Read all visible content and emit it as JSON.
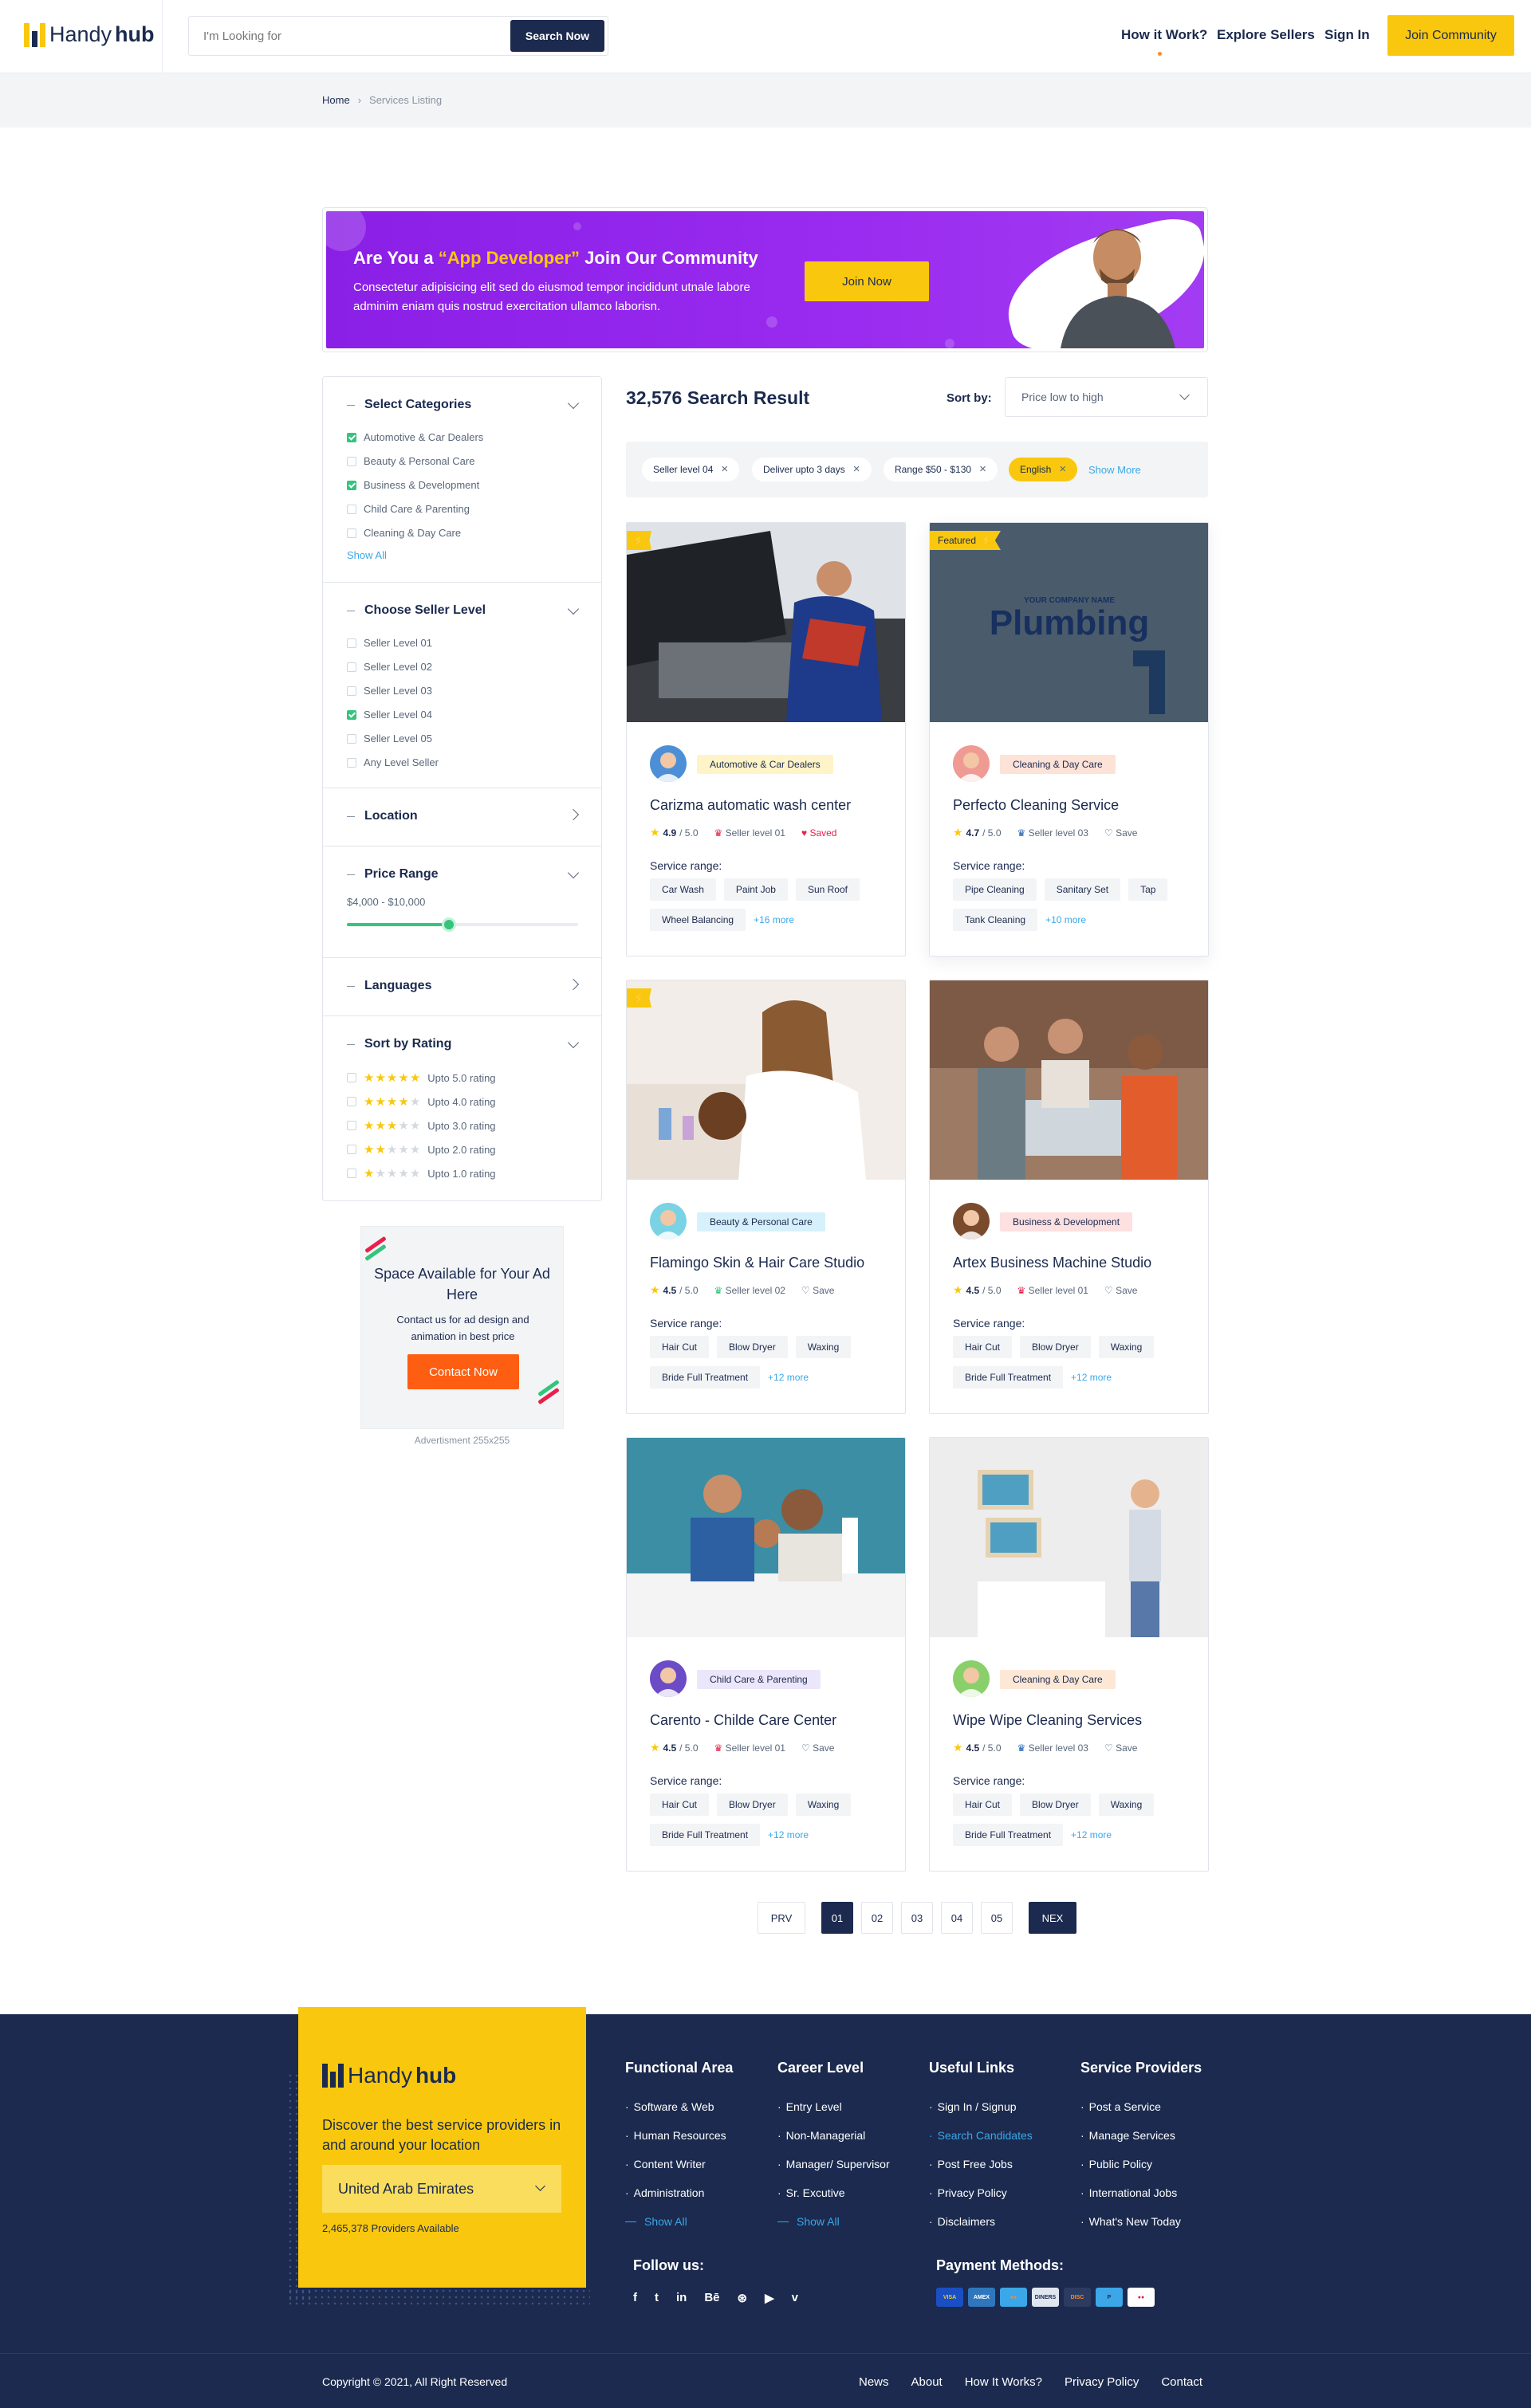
{
  "header": {
    "logo_light": "Handy",
    "logo_bold": "hub",
    "search_placeholder": "I'm Looking for",
    "search_button": "Search Now",
    "nav": [
      "How it Work?",
      "Explore Sellers",
      "Sign In"
    ],
    "join_button": "Join Community"
  },
  "breadcrumb": {
    "home": "Home",
    "separator": "›",
    "current": "Services Listing"
  },
  "banner": {
    "title_pre": "Are You a ",
    "title_highlight": "“App Developer”",
    "title_post": " Join Our Community",
    "text": "Consectetur adipisicing elit sed do eiusmod tempor incididunt utnale labore adminim eniam quis nostrud exercitation ullamco laborisn.",
    "button": "Join Now"
  },
  "filters": {
    "categories": {
      "title": "Select Categories",
      "options": [
        {
          "label": "Automotive & Car Dealers",
          "checked": true
        },
        {
          "label": "Beauty & Personal Care",
          "checked": false
        },
        {
          "label": "Business & Development",
          "checked": true
        },
        {
          "label": "Child Care & Parenting",
          "checked": false
        },
        {
          "label": "Cleaning & Day Care",
          "checked": false
        }
      ],
      "show_all": "Show All"
    },
    "seller_level": {
      "title": "Choose Seller Level",
      "options": [
        {
          "label": "Seller Level 01",
          "checked": false
        },
        {
          "label": "Seller Level 02",
          "checked": false
        },
        {
          "label": "Seller Level 03",
          "checked": false
        },
        {
          "label": "Seller Level 04",
          "checked": true
        },
        {
          "label": "Seller Level 05",
          "checked": false
        },
        {
          "label": "Any Level Seller",
          "checked": false
        }
      ]
    },
    "location": {
      "title": "Location"
    },
    "price": {
      "title": "Price Range",
      "value": "$4,000 - $10,000",
      "fraction": 0.44
    },
    "languages": {
      "title": "Languages"
    },
    "rating": {
      "title": "Sort by Rating",
      "options": [
        {
          "label": "Upto 5.0 rating",
          "stars": 5
        },
        {
          "label": "Upto 4.0 rating",
          "stars": 4
        },
        {
          "label": "Upto 3.0 rating",
          "stars": 3
        },
        {
          "label": "Upto 2.0 rating",
          "stars": 2
        },
        {
          "label": "Upto 1.0 rating",
          "stars": 1
        }
      ]
    }
  },
  "ad": {
    "title": "Space Available for Your Ad Here",
    "text": "Contact us for ad design and animation in best price",
    "button": "Contact Now",
    "caption": "Advertisment 255x255"
  },
  "results": {
    "count_title": "32,576 Search Result",
    "sort_label": "Sort by:",
    "sort_value": "Price low to high",
    "chips": [
      "Seller level 04",
      "Deliver upto 3 days",
      "Range $50 - $130",
      "English"
    ],
    "chip_remove": "×",
    "show_more": "Show More"
  },
  "cards": [
    {
      "badge": "",
      "category": "Automotive & Car Dealers",
      "cat_color": "#fff4c7",
      "title": "Carizma automatic wash center",
      "rating": "4.9",
      "rating_max": "/ 5.0",
      "level": "Seller level 01",
      "save": "Saved",
      "saved": true,
      "range_label": "Service range:",
      "tags": [
        "Car Wash",
        "Paint Job",
        "Sun Roof",
        "Wheel Balancing"
      ],
      "more": "+16 more"
    },
    {
      "badge": "Featured",
      "category": "Cleaning & Day Care",
      "cat_color": "#fde2d8",
      "title": "Perfecto Cleaning Service",
      "rating": "4.7",
      "rating_max": "/ 5.0",
      "level": "Seller level 03",
      "save": "Save",
      "saved": false,
      "range_label": "Service range:",
      "tags": [
        "Pipe Cleaning",
        "Sanitary Set",
        "Tap",
        "Tank Cleaning"
      ],
      "more": "+10 more",
      "image_text_a": "YOUR COMPANY NAME",
      "image_text_b": "Plumbing"
    },
    {
      "badge": "",
      "category": "Beauty & Personal Care",
      "cat_color": "#d6f1fb",
      "title": "Flamingo Skin & Hair Care Studio",
      "rating": "4.5",
      "rating_max": "/ 5.0",
      "level": "Seller level 02",
      "save": "Save",
      "saved": false,
      "range_label": "Service range:",
      "tags": [
        "Hair Cut",
        "Blow Dryer",
        "Waxing",
        "Bride Full Treatment"
      ],
      "more": "+12 more"
    },
    {
      "badge": "",
      "category": "Business & Development",
      "cat_color": "#fde0e0",
      "title": "Artex Business Machine Studio",
      "rating": "4.5",
      "rating_max": "/ 5.0",
      "level": "Seller level 01",
      "save": "Save",
      "saved": false,
      "range_label": "Service range:",
      "tags": [
        "Hair Cut",
        "Blow Dryer",
        "Waxing",
        "Bride Full Treatment"
      ],
      "more": "+12 more"
    },
    {
      "badge": "",
      "category": "Child Care & Parenting",
      "cat_color": "#ece6fb",
      "title": "Carento - Childe Care Center",
      "rating": "4.5",
      "rating_max": "/ 5.0",
      "level": "Seller level 01",
      "save": "Save",
      "saved": false,
      "range_label": "Service range:",
      "tags": [
        "Hair Cut",
        "Blow Dryer",
        "Waxing",
        "Bride Full Treatment"
      ],
      "more": "+12 more"
    },
    {
      "badge": "",
      "category": "Cleaning & Day Care",
      "cat_color": "#fde8d6",
      "title": "Wipe Wipe Cleaning Services",
      "rating": "4.5",
      "rating_max": "/ 5.0",
      "level": "Seller level 03",
      "save": "Save",
      "saved": false,
      "range_label": "Service range:",
      "tags": [
        "Hair Cut",
        "Blow Dryer",
        "Waxing",
        "Bride Full Treatment"
      ],
      "more": "+12 more"
    }
  ],
  "pagination": {
    "prev": "PRV",
    "pages": [
      "01",
      "02",
      "03",
      "04",
      "05"
    ],
    "active_index": 0,
    "next": "NEX"
  },
  "footer": {
    "logo_light": "Handy",
    "logo_bold": "hub",
    "tagline": "Discover the best service providers in and around your location",
    "country": "United Arab Emirates",
    "providers": "2,465,378 Providers Available",
    "columns": [
      {
        "title": "Functional Area",
        "items": [
          "Software & Web",
          "Human Resources",
          "Content Writer",
          "Administration"
        ],
        "show_all": "Show All"
      },
      {
        "title": "Career Level",
        "items": [
          "Entry Level",
          "Non-Managerial",
          "Manager/ Supervisor",
          "Sr. Excutive"
        ],
        "show_all": "Show All"
      },
      {
        "title": "Useful Links",
        "items": [
          "Sign In / Signup",
          "Search Candidates",
          "Post Free Jobs",
          "Privacy Policy",
          "Disclaimers"
        ],
        "highlight_index": 1
      },
      {
        "title": "Service Providers",
        "items": [
          "Post a Service",
          "Manage Services",
          "Public Policy",
          "International Jobs",
          "What's New Today"
        ]
      }
    ],
    "follow_title": "Follow us:",
    "social_icons": [
      "facebook-icon",
      "twitter-icon",
      "linkedin-icon",
      "behance-icon",
      "dribbble-icon",
      "youtube-icon",
      "vimeo-icon"
    ],
    "social_glyphs": [
      "f",
      "t",
      "in",
      "Bē",
      "⊛",
      "▶",
      "v"
    ],
    "payment_title": "Payment Methods:",
    "payment_cards": [
      {
        "name": "visa-icon",
        "label": "VISA",
        "bg": "#1a4fc4",
        "fg": "#f9c80e"
      },
      {
        "name": "amex-icon",
        "label": "AMEX",
        "bg": "#2e77bc",
        "fg": "#fff"
      },
      {
        "name": "mastercard-icon",
        "label": "●●",
        "bg": "#3ba7e8",
        "fg": "#f98b2c"
      },
      {
        "name": "diners-icon",
        "label": "DINERS",
        "bg": "#dfe6ef",
        "fg": "#1b2a4e"
      },
      {
        "name": "discover-icon",
        "label": "DISC",
        "bg": "#2b3b61",
        "fg": "#f98b2c"
      },
      {
        "name": "paypal-icon",
        "label": "P",
        "bg": "#3ba7e8",
        "fg": "#1b2a4e"
      },
      {
        "name": "maestro-icon",
        "label": "●●",
        "bg": "#fff",
        "fg": "#e8214a"
      }
    ],
    "copyright": "Copyright © 2021, All Right Reserved",
    "links": [
      "News",
      "About",
      "How It Works?",
      "Privacy Policy",
      "Contact"
    ]
  },
  "colors": {
    "navy": "#1b2a4e",
    "yellow": "#f9c80e",
    "green": "#34c47c",
    "orange": "#fe5e12",
    "blue": "#3ba7e8",
    "purple": "#8a1fe6"
  }
}
